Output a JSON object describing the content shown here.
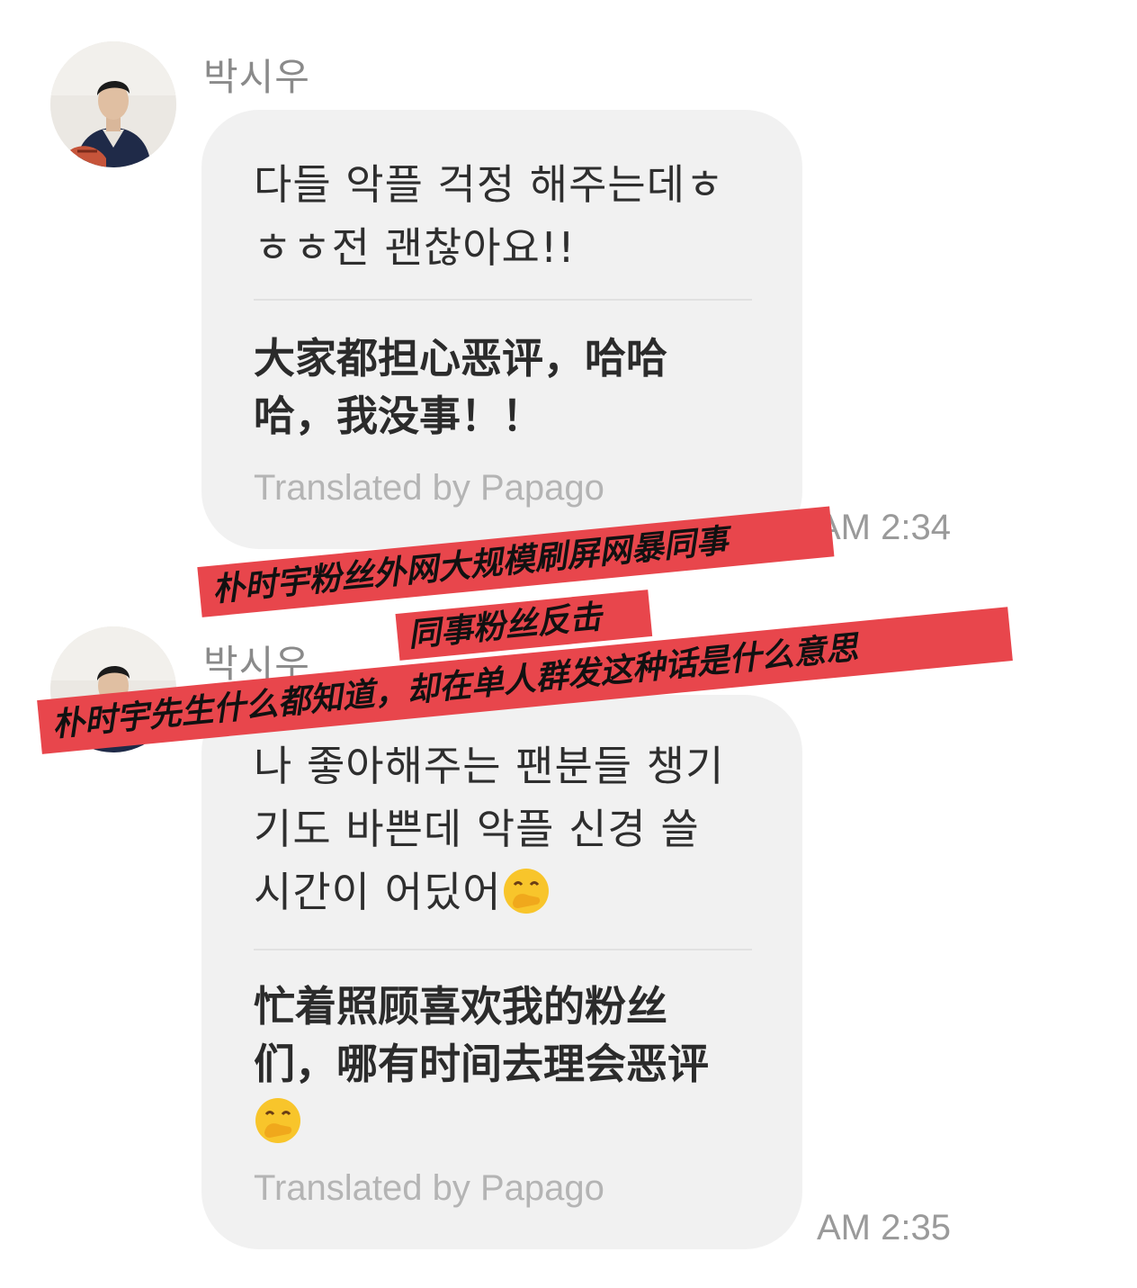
{
  "messages": [
    {
      "sender": "박시우",
      "avatar_icon": "profile-photo",
      "original_lines": [
        "다들 악플 걱정 해주는데ㅎ",
        "ㅎㅎ전 괜찮아요!!"
      ],
      "translation_lines": [
        "大家都担心恶评，哈哈",
        "哈，我没事！！"
      ],
      "translated_by": "Translated by Papago",
      "time": "AM 2:34"
    },
    {
      "sender": "박시우",
      "avatar_icon": "profile-photo",
      "original_lines": [
        "나 좋아해주는 팬분들 챙기",
        "기도 바쁜데 악플 신경 쓸",
        "시간이 어딨어"
      ],
      "original_emoji": "hand-over-mouth-emoji",
      "translation_lines": [
        "忙着照顾喜欢我的粉丝",
        "们，哪有时间去理会恶评"
      ],
      "translation_emoji": "hand-over-mouth-emoji",
      "translated_by": "Translated by Papago",
      "time": "AM 2:35"
    }
  ],
  "overlay_banners": [
    {
      "text": "朴时宇粉丝外网大规模刷屏网暴同事"
    },
    {
      "text": "同事粉丝反击"
    },
    {
      "text": "朴时宇先生什么都知道，却在单人群发这种话是什么意思"
    }
  ],
  "colors": {
    "bubble": "#f1f1f1",
    "banner": "#e8464c",
    "muted_text": "#9a9a9a"
  }
}
